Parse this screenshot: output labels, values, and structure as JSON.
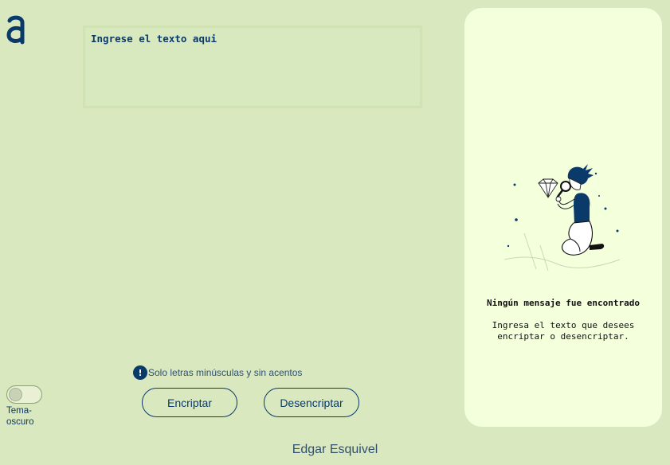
{
  "editor": {
    "placeholder": "Ingrese el texto aqui"
  },
  "hint": {
    "icon": "!",
    "text": "Solo letras minúsculas y sin acentos"
  },
  "buttons": {
    "encrypt_label": "Encriptar",
    "decrypt_label": "Desencriptar"
  },
  "theme_toggle": {
    "label": "Tema-oscuro",
    "checked": false
  },
  "output_panel": {
    "title": "Ningún mensaje fue encontrado",
    "description": "Ingresa el texto que desees encriptar o desencriptar."
  },
  "footer": {
    "author": "Edgar Esquivel"
  },
  "colors": {
    "background": "#d9e8bf",
    "panel": "#f4ffdc",
    "accent": "#0a3a6a"
  },
  "icons": {
    "logo": "alura-logo",
    "illustration": "person-with-magnifying-glass"
  }
}
